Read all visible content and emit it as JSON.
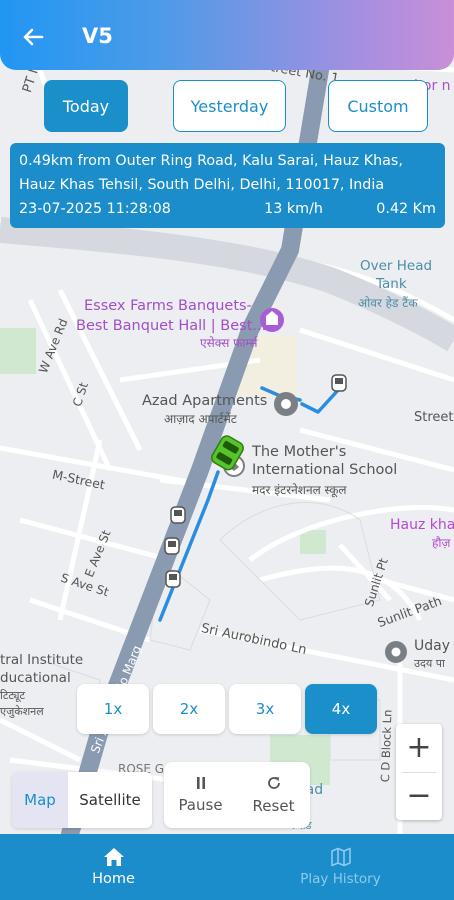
{
  "header": {
    "title": "V5",
    "back_icon": "arrow-left-icon"
  },
  "date_range": {
    "options": [
      "Today",
      "Yesterday",
      "Custom"
    ],
    "selected": "Today"
  },
  "location_info": {
    "address_line1": "0.49km from Outer Ring Road, Kalu Sarai, Hauz Khas,",
    "address_line2": "Hauz Khas Tehsil, South Delhi, Delhi, 110017, India",
    "timestamp": "23-07-2025 11:28:08",
    "speed": "13 km/h",
    "distance": "0.42 Km"
  },
  "map_labels": {
    "pt_nalin": "PT Na",
    "streetno": "treet No. 1",
    "mor": "hor n",
    "over_head_tank": "Over Head",
    "tank": "Tank",
    "over_head_hindi": "ओवर हेड टैंक",
    "essex1": "Essex Farms Banquets-",
    "essex2": "Best Banquet Hall | Best...",
    "essex_hindi": "एसेक्स फार्म्स",
    "w_ave_rd": "W Ave Rd",
    "c_st": "C St",
    "azad1": "Azad Apartments",
    "azad_hindi": "आज़ाद अपार्टमेंट",
    "street": "Street",
    "mothers1": "The Mother's",
    "mothers2": "International School",
    "mothers_hindi": "मदर इंटरनेशनल स्कूल",
    "m_street": "M-Street",
    "hauz_khas": "Hauz kha",
    "hauz_khas_hindi": "हौज़",
    "e_ave_st": "E Ave St",
    "s_ave_st": "S Ave St",
    "sunlit_pt": "Sunlit Pt",
    "sunlit_path": "Sunlit Path",
    "sri_aurobindo_ln": "Sri Aurobindo Ln",
    "sri_marg": "Sri Aurobindo Marg",
    "uday": "Uday",
    "uday_hindi": "उदय पा",
    "institute1": "tral Institute",
    "institute2": "ducational",
    "institute3": "टिट्यूट",
    "institute4": "एजुकेशनल",
    "cd_block_ln": "C D Block Ln",
    "rose": "ROSE G",
    "road_bottom": "Road",
    "road_hindi": "ध रोड"
  },
  "speed_options": {
    "items": [
      "1x",
      "2x",
      "3x",
      "4x"
    ],
    "selected": "4x"
  },
  "zoom": {
    "in_label": "+",
    "out_label": "−"
  },
  "map_type": {
    "options": [
      "Map",
      "Satellite"
    ],
    "selected": "Map"
  },
  "playback": {
    "pause_label": "Pause",
    "pause_icon": "pause-icon",
    "reset_label": "Reset",
    "reset_icon": "refresh-icon"
  },
  "bottom_nav": {
    "items": [
      {
        "label": "Home",
        "icon": "home-icon",
        "active": true
      },
      {
        "label": "Play History",
        "icon": "map-icon",
        "active": false
      }
    ]
  },
  "colors": {
    "primary": "#1c8dcb",
    "route": "#2a8ee0",
    "vehicle": "#57c42c",
    "main_road": "#8a9ab0"
  }
}
